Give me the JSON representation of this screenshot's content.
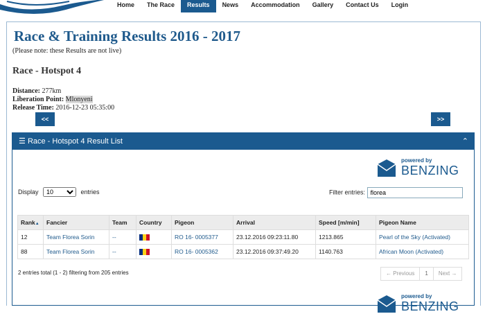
{
  "nav": {
    "items": [
      "Home",
      "The Race",
      "Results",
      "News",
      "Accommodation",
      "Gallery",
      "Contact Us",
      "Login"
    ],
    "active": "Results"
  },
  "page": {
    "title": "Race & Training Results 2016 - 2017",
    "note": "(Please note: these Results are not live)",
    "race_title": "Race - Hotspot 4",
    "distance_label": "Distance:",
    "distance": "277km",
    "liberation_label": "Liberation Point:",
    "liberation": "Mlonyeni",
    "release_label": "Release Time:",
    "release": "2016-12-23 05:35:00",
    "prev": "<<",
    "next": ">>"
  },
  "panel": {
    "title": "Race - Hotspot 4 Result List",
    "brand_top": "powered by",
    "brand": "BENZING",
    "display_label": "Display",
    "display_value": "10",
    "entries_label": "entries",
    "filter_label": "Filter entries:",
    "filter_value": "florea",
    "columns": [
      "Rank",
      "Fancier",
      "Team",
      "Country",
      "Pigeon",
      "Arrival",
      "Speed [m/min]",
      "Pigeon Name"
    ],
    "rows": [
      {
        "rank": "12",
        "fancier": "Team Florea Sorin",
        "team": "--",
        "pigeon": "RO 16- 0005377",
        "arrival": "23.12.2016 09:23:11.80",
        "speed": "1213.865",
        "name": "Pearl of the Sky (Activated)"
      },
      {
        "rank": "88",
        "fancier": "Team Florea Sorin",
        "team": "--",
        "pigeon": "RO 16- 0005362",
        "arrival": "23.12.2016 09:37:49.20",
        "speed": "1140.763",
        "name": "African Moon (Activated)"
      }
    ],
    "summary": "2 entries total (1 - 2) filtering from 205 entries",
    "pager": {
      "previous": "← Previous",
      "page": "1",
      "next": "Next →"
    }
  },
  "colors": {
    "brand_blue": "#1b5a8f",
    "flag_blue": "#002b7f",
    "flag_yellow": "#fcd116",
    "flag_red": "#ce1126"
  }
}
